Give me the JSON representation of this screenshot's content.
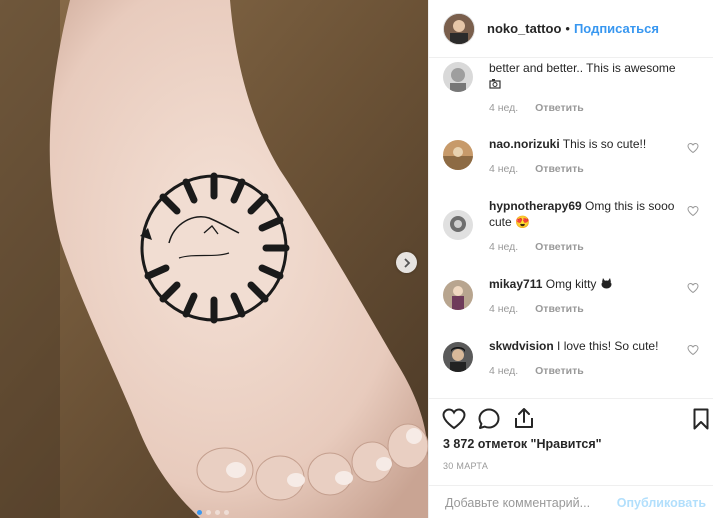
{
  "header": {
    "username": "noko_tattoo",
    "separator": "•",
    "follow_label": "Подписаться"
  },
  "comments": [
    {
      "user": "",
      "text": "better and better.. This is awesome",
      "emoji_icon": "camera-emoji",
      "age": "4 нед.",
      "reply": "Ответить"
    },
    {
      "user": "nao.norizuki",
      "text": "This is so cute!!",
      "age": "4 нед.",
      "reply": "Ответить"
    },
    {
      "user": "hypnotherapy69",
      "text": "Omg this is sooo cute 😍",
      "age": "4 нед.",
      "reply": "Ответить"
    },
    {
      "user": "mikay711",
      "text": "Omg kitty",
      "emoji_icon": "cat-emoji",
      "age": "4 нед.",
      "reply": "Ответить"
    },
    {
      "user": "skwdvision",
      "text": "I love this! So cute!",
      "age": "4 нед.",
      "reply": "Ответить"
    }
  ],
  "actions": {
    "likes": "3 872 отметок \"Нравится\"",
    "date": "30 марта"
  },
  "composer": {
    "placeholder": "Добавьте комментарий...",
    "post_label": "Опубликовать"
  },
  "carousel": {
    "slides": 4,
    "active": 1
  },
  "colors": {
    "accent": "#3897f0",
    "muted": "#999999",
    "text": "#262626",
    "post_disabled": "#b2dffc"
  }
}
